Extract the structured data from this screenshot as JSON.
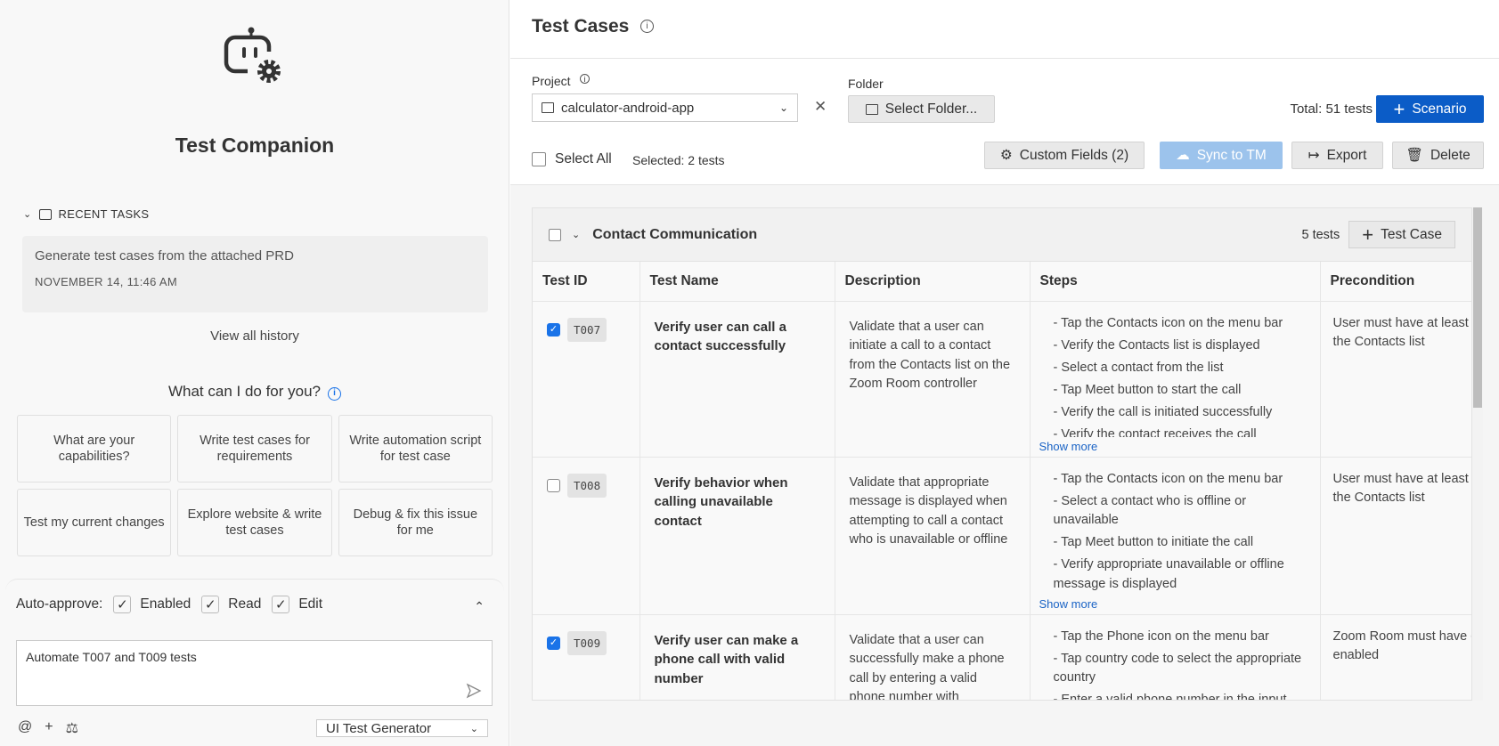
{
  "companion": {
    "title": "Test Companion",
    "recent_tasks_label": "RECENT TASKS",
    "recent_tasks": [
      {
        "title": "Generate test cases from the attached PRD",
        "time": "NOVEMBER 14, 11:46 AM"
      }
    ],
    "view_all_history": "View all history",
    "prompt_heading": "What can I do for you?",
    "suggestions": [
      "What are your capabilities?",
      "Write test cases for requirements",
      "Write automation script for test case",
      "Test my current changes",
      "Explore website & write test cases",
      "Debug & fix this issue for me"
    ],
    "auto_approve": {
      "label": "Auto-approve:",
      "options": [
        {
          "label": "Enabled",
          "checked": true
        },
        {
          "label": "Read",
          "checked": true
        },
        {
          "label": "Edit",
          "checked": true
        }
      ]
    },
    "input_value": "Automate T007 and T009 tests",
    "agent_select": "UI Test Generator"
  },
  "testcases": {
    "title": "Test Cases",
    "project_label": "Project",
    "project_value": "calculator-android-app",
    "folder_label": "Folder",
    "folder_button": "Select Folder...",
    "total": "Total: 51 tests",
    "scenario_button": "Scenario",
    "select_all": "Select All",
    "selected": "Selected: 2 tests",
    "custom_fields": "Custom Fields (2)",
    "sync": "Sync to TM",
    "export": "Export",
    "delete": "Delete",
    "group": {
      "name": "Contact Communication",
      "count": "5 tests",
      "add_button": "Test Case"
    },
    "columns": [
      "Test ID",
      "Test Name",
      "Description",
      "Steps",
      "Precondition"
    ],
    "show_more": "Show more",
    "rows": [
      {
        "id": "T007",
        "checked": true,
        "name": "Verify user can call a contact successfully",
        "description": "Validate that a user can initiate a call to a contact from the Contacts list on the Zoom Room controller",
        "steps": [
          "- Tap the Contacts icon on the menu bar",
          "- Verify the Contacts list is displayed",
          "- Select a contact from the list",
          "- Tap Meet button to start the call",
          "- Verify the call is initiated successfully",
          "- Verify the contact receives the call"
        ],
        "precondition": "User must have at least one contact in the Contacts list"
      },
      {
        "id": "T008",
        "checked": false,
        "name": "Verify behavior when calling unavailable contact",
        "description": "Validate that appropriate message is displayed when attempting to call a contact who is unavailable or offline",
        "steps": [
          "- Tap the Contacts icon on the menu bar",
          "- Select a contact who is offline or unavailable",
          "- Tap Meet button to initiate the call",
          "- Verify appropriate unavailable or offline message is displayed"
        ],
        "precondition": "User must have at least one contact in the Contacts list"
      },
      {
        "id": "T009",
        "checked": true,
        "name": "Verify user can make a phone call with valid number",
        "description": "Validate that a user can successfully make a phone call by entering a valid phone number with",
        "steps": [
          "- Tap the Phone icon on the menu bar",
          "- Tap country code to select the appropriate country",
          "- Enter a valid phone number in the input"
        ],
        "precondition": "Zoom Room must have capability enabled"
      }
    ]
  },
  "colors": {
    "primary": "#0b5cc7",
    "checkbox": "#1a73e8",
    "link": "#1a63c5"
  }
}
